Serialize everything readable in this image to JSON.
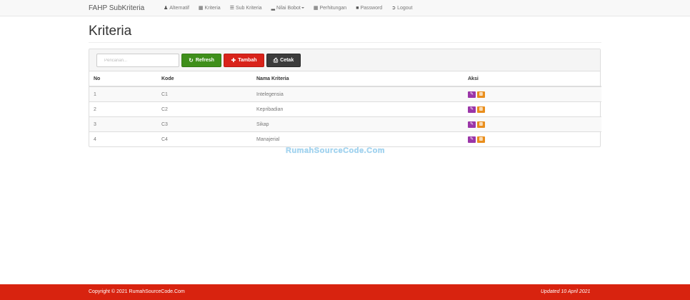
{
  "navbar": {
    "brand": "FAHP SubKriteria",
    "items": [
      {
        "label": "Alternatif",
        "icon": "user-icon"
      },
      {
        "label": "Kriteria",
        "icon": "th-large-icon"
      },
      {
        "label": "Sub Kriteria",
        "icon": "list-icon"
      },
      {
        "label": "Nilai Bobot",
        "icon": "signal-icon"
      },
      {
        "label": "Perhitungan",
        "icon": "calendar-icon"
      },
      {
        "label": "Password",
        "icon": "lock-icon"
      },
      {
        "label": "Logout",
        "icon": "log-out-icon"
      }
    ]
  },
  "page": {
    "title": "Kriteria"
  },
  "toolbar": {
    "search_placeholder": "Pencarian...",
    "refresh_label": "Refresh",
    "tambah_label": "Tambah",
    "cetak_label": "Cetak"
  },
  "table": {
    "headers": [
      "No",
      "Kode",
      "Nama Kriteria",
      "Aksi"
    ],
    "rows": [
      [
        "1",
        "C1",
        "Intelegensia"
      ],
      [
        "2",
        "C2",
        "Kepribadian"
      ],
      [
        "3",
        "C3",
        "Sikap"
      ],
      [
        "4",
        "C4",
        "Manajerial"
      ]
    ]
  },
  "watermark": "RumahSourceCode.Com",
  "footer": {
    "copyright": "Copyright © 2021 RumahSourceCode.Com",
    "updated": "Updated 10 April 2021"
  },
  "colors": {
    "refresh": "#3f8f1b",
    "tambah": "#d9231a",
    "cetak": "#3c3c3c",
    "edit": "#9b36a8",
    "delete": "#e98e1c",
    "footer": "#d8230f"
  }
}
